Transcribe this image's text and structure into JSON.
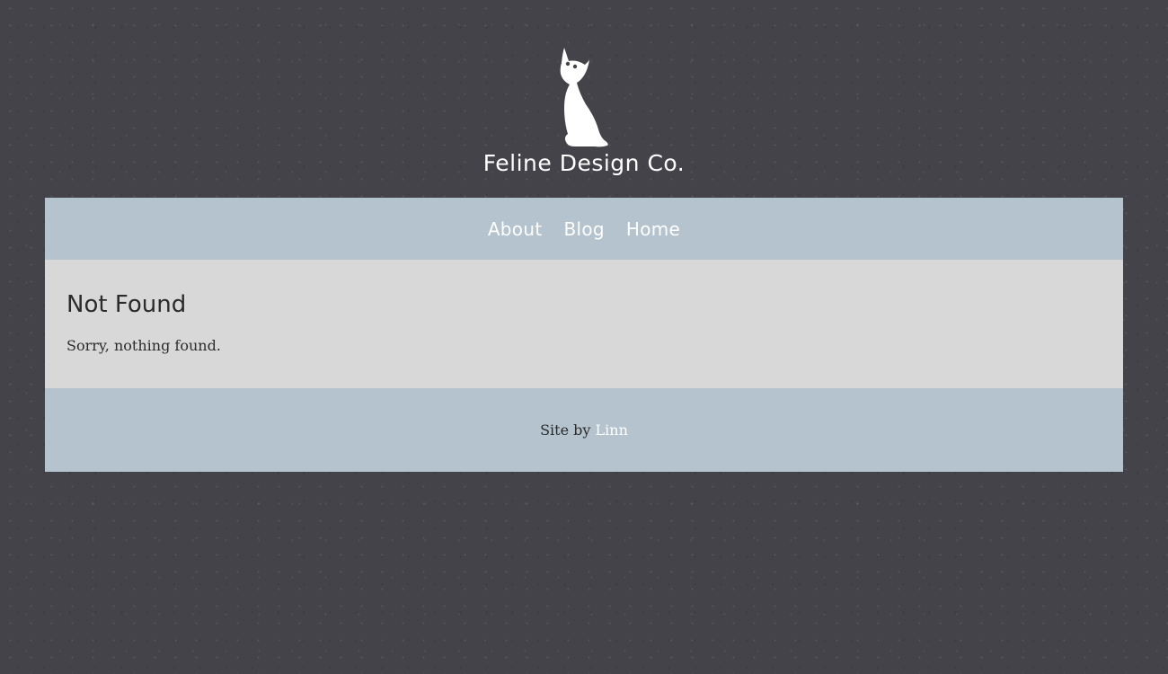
{
  "header": {
    "logo_icon": "cat-silhouette-icon",
    "site_title": "Feline Design Co."
  },
  "nav": {
    "items": [
      {
        "label": "About"
      },
      {
        "label": "Blog"
      },
      {
        "label": "Home"
      }
    ]
  },
  "main": {
    "heading": "Not Found",
    "message": "Sorry, nothing found."
  },
  "footer": {
    "credit_prefix": "Site by",
    "credit_link": "Linn"
  },
  "colors": {
    "background": "#44434a",
    "nav_background": "#b4c3ce",
    "content_background": "#d9d8d9",
    "text": "#2b2b2b",
    "link": "#ffffff"
  }
}
